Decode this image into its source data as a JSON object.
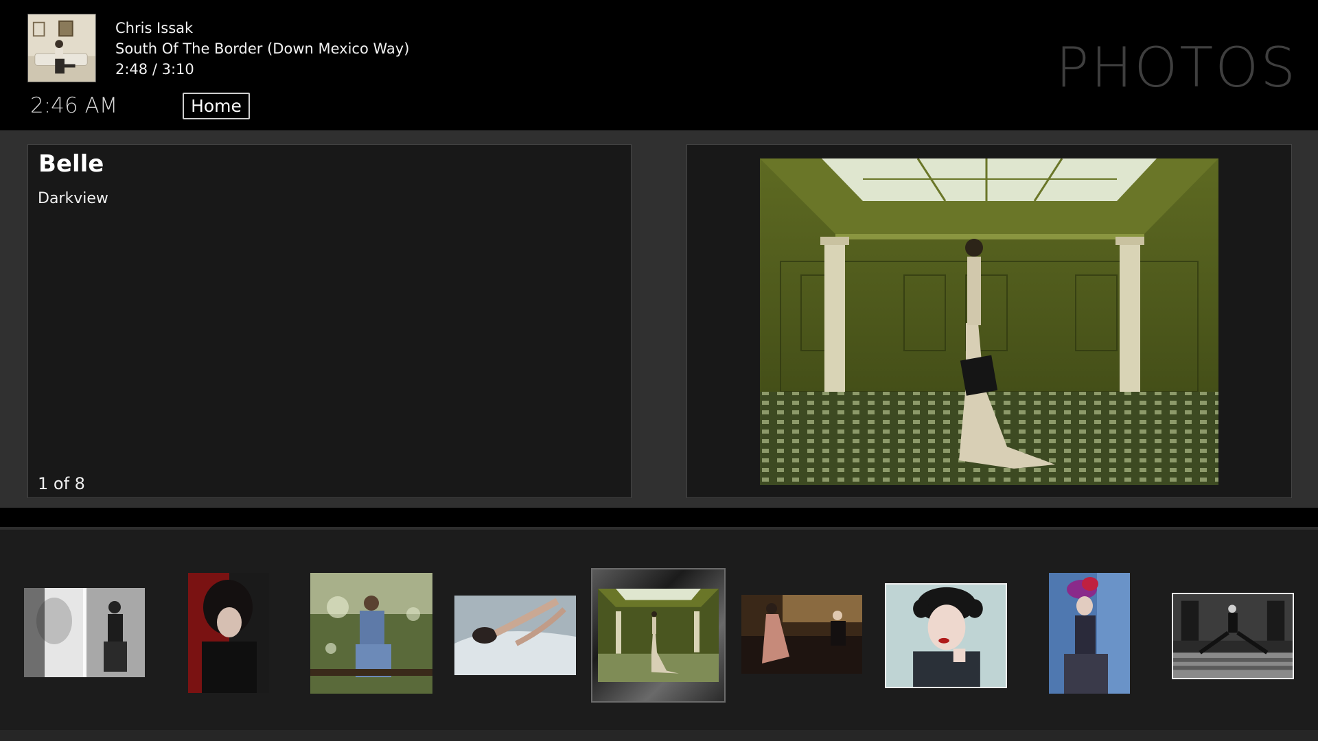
{
  "header": {
    "artist": "Chris Issak",
    "song": "South Of The Border (Down Mexico Way)",
    "progress": "2:48 / 3:10",
    "clock": "2:46 AM",
    "home_label": "Home",
    "section_title": "PHOTOS"
  },
  "details": {
    "title": "Belle",
    "subtitle": "Darkview",
    "counter": "1 of 8"
  },
  "icons": {
    "album_art": "album-art-thumbnail"
  },
  "colors": {
    "background": "#000000",
    "panel": "#181818",
    "band": "#303030",
    "title_gray": "#3f3f3f"
  }
}
